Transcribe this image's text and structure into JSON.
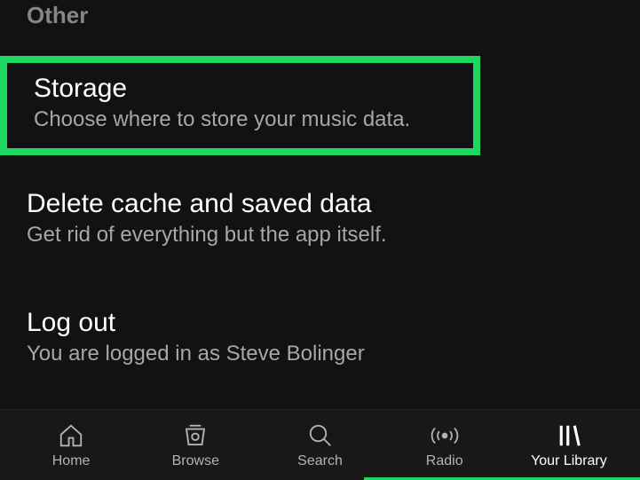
{
  "sectionHeader": "Other",
  "settings": {
    "storage": {
      "title": "Storage",
      "description": "Choose where to store your music data."
    },
    "deleteCache": {
      "title": "Delete cache and saved data",
      "description": "Get rid of everything but the app itself."
    },
    "logout": {
      "title": "Log out",
      "description": "You are logged in as Steve Bolinger"
    }
  },
  "nav": {
    "home": "Home",
    "browse": "Browse",
    "search": "Search",
    "radio": "Radio",
    "library": "Your Library"
  }
}
